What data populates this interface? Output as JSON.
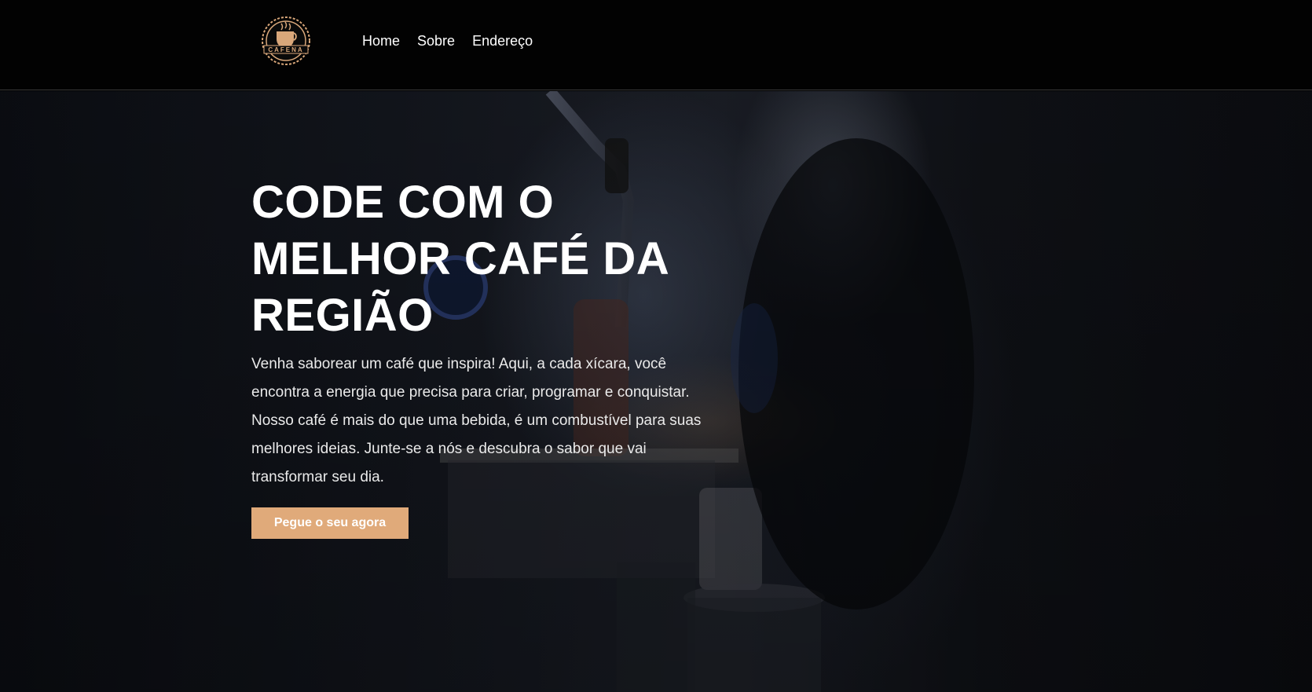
{
  "logo": {
    "text": "CAFENA",
    "icon": "coffee-cup-gear-logo"
  },
  "nav": {
    "items": [
      {
        "label": "Home"
      },
      {
        "label": "Sobre"
      },
      {
        "label": "Endereço"
      }
    ]
  },
  "hero": {
    "title": "CODE COM O MELHOR CAFÉ DA REGIÃO",
    "text": "Venha saborear um café que inspira! Aqui, a cada xícara, você encontra a energia que precisa para criar, programar e conquistar. Nosso café é mais do que uma bebida, é um combustível para suas melhores ideias. Junte-se a nós e descubra o sabor que vai transformar seu dia.",
    "cta_label": "Pegue o seu agora"
  },
  "colors": {
    "accent": "#e0aa7a",
    "nav_background": "#020202",
    "text": "#ffffff"
  }
}
